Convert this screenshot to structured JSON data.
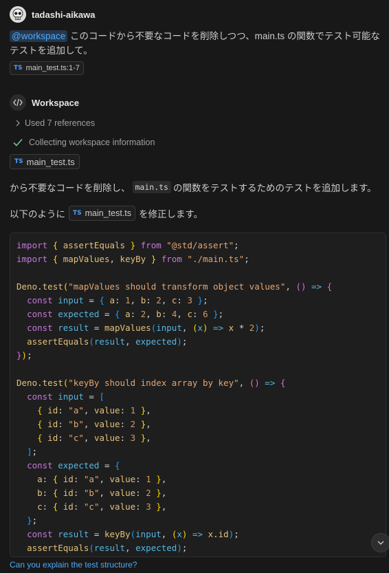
{
  "user": {
    "name": "tadashi-aikawa"
  },
  "prompt": {
    "mention": "@workspace",
    "text": " このコードから不要なコードを削除しつつ、main.ts の関数でテスト可能なテストを追加して。",
    "reference": "main_test.ts:1-7",
    "reference_lang": "TS"
  },
  "agent": {
    "name": "Workspace",
    "used_refs": "Used 7 references",
    "collecting": "Collecting workspace information",
    "file_chip": "main_test.ts",
    "file_lang": "TS"
  },
  "response": {
    "line1_before": "から不要なコードを削除し、",
    "line1_code": "main.ts",
    "line1_after": "の関数をテストするためのテストを追加します。",
    "line2_before": "以下のように",
    "line2_chip": "main_test.ts",
    "line2_after": "を修正します。"
  },
  "followup": "Can you explain the test structure?",
  "icons": {
    "avatar": "skull-avatar-icon",
    "workspace": "code-brackets-icon",
    "chevron": "chevron-right-icon",
    "check": "check-icon",
    "scroll": "chevron-down-icon"
  },
  "colors": {
    "mention": "#4daafc",
    "link": "#4daafc",
    "check": "#73c991",
    "ts": "#4a9eff"
  }
}
